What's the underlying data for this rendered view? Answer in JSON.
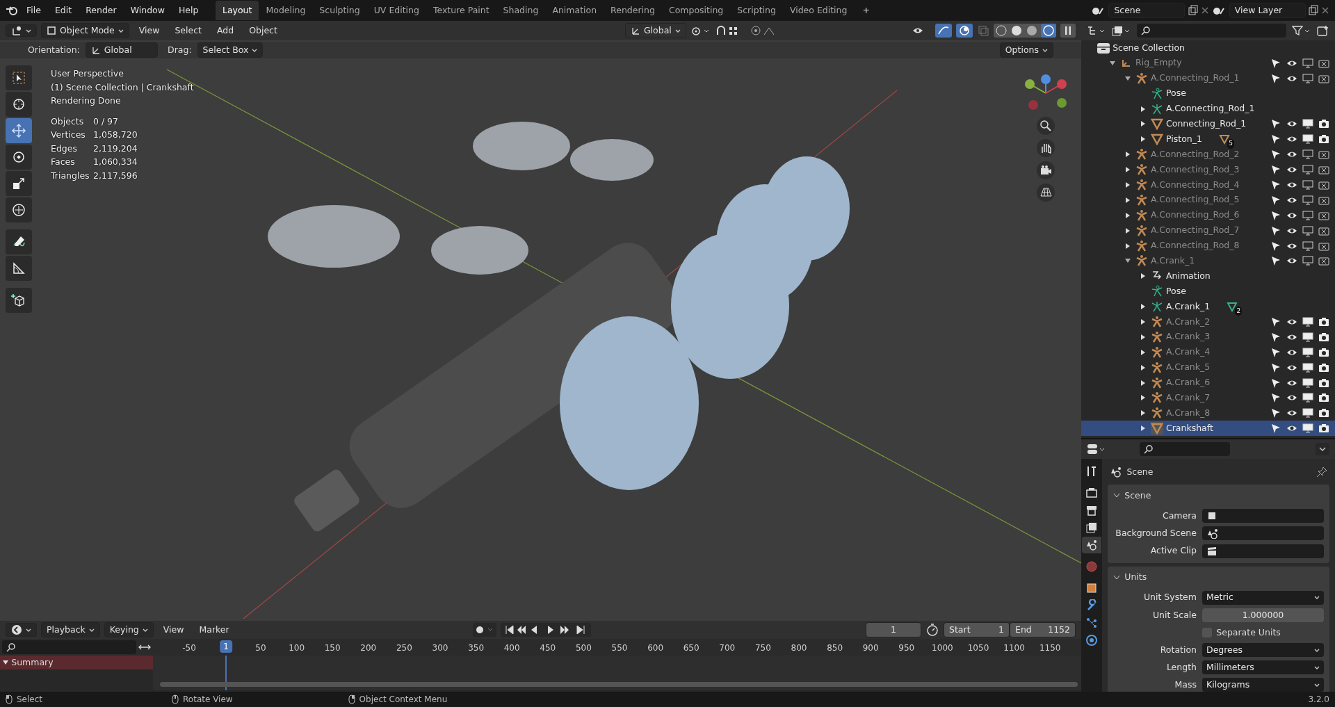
{
  "menu": [
    "File",
    "Edit",
    "Render",
    "Window",
    "Help"
  ],
  "workspaces": [
    {
      "label": "Layout",
      "selected": true
    },
    {
      "label": "Modeling",
      "selected": false
    },
    {
      "label": "Sculpting",
      "selected": false
    },
    {
      "label": "UV Editing",
      "selected": false
    },
    {
      "label": "Texture Paint",
      "selected": false
    },
    {
      "label": "Shading",
      "selected": false
    },
    {
      "label": "Animation",
      "selected": false
    },
    {
      "label": "Rendering",
      "selected": false
    },
    {
      "label": "Compositing",
      "selected": false
    },
    {
      "label": "Scripting",
      "selected": false
    },
    {
      "label": "Video Editing",
      "selected": false
    }
  ],
  "add_workspace": "+",
  "scene": "Scene",
  "view_layer": "View Layer",
  "viewport_header": {
    "mode": "Object Mode",
    "menus": [
      "View",
      "Select",
      "Add",
      "Object"
    ],
    "transform": "Global"
  },
  "tool_settings": {
    "orientation_label": "Orientation:",
    "orientation": "Global",
    "drag_label": "Drag:",
    "drag": "Select Box",
    "options": "Options"
  },
  "tools": [
    {
      "kind": "select",
      "selected": false
    },
    {
      "kind": "cursor",
      "selected": false
    },
    {
      "kind": "move",
      "selected": true
    },
    {
      "kind": "rotate",
      "selected": false
    },
    {
      "kind": "scale",
      "selected": false
    },
    {
      "kind": "transform",
      "selected": false
    },
    {
      "kind": "annotate",
      "selected": false
    },
    {
      "kind": "measure",
      "selected": false
    },
    {
      "kind": "add_cube",
      "selected": false
    }
  ],
  "overlay": {
    "lines": [
      "User Perspective",
      "(1) Scene Collection | Crankshaft",
      "Rendering Done"
    ],
    "stats": [
      {
        "label": "Objects",
        "value": "0 / 97"
      },
      {
        "label": "Vertices",
        "value": "1,058,720"
      },
      {
        "label": "Edges",
        "value": "2,119,204"
      },
      {
        "label": "Faces",
        "value": "1,060,334"
      },
      {
        "label": "Triangles",
        "value": "2,117,596"
      }
    ]
  },
  "outliner": {
    "root": "Scene Collection",
    "items": [
      {
        "name": "Rig_Empty",
        "kind": "empty",
        "disabled": true,
        "expanded": true,
        "selected": false,
        "renderable": false,
        "children": [
          {
            "name": "A.Connecting_Rod_1",
            "kind": "armature",
            "disabled": true,
            "expanded": true,
            "selected": false,
            "renderable": false,
            "children": [
              {
                "name": "Pose",
                "kind": "pose",
                "disabled": false,
                "selected": false
              },
              {
                "name": "A.Connecting_Rod_1",
                "kind": "armature_data",
                "disabled": false,
                "expanded": false,
                "selected": false
              },
              {
                "name": "Connecting_Rod_1",
                "kind": "mesh",
                "disabled": false,
                "expanded": false,
                "selected": false,
                "renderable": true
              },
              {
                "name": "Piston_1",
                "kind": "mesh",
                "disabled": false,
                "expanded": false,
                "selected": false,
                "renderable": true,
                "badge": "5"
              }
            ]
          },
          {
            "name": "A.Connecting_Rod_2",
            "kind": "armature",
            "disabled": true,
            "expanded": false,
            "selected": false,
            "renderable": false
          },
          {
            "name": "A.Connecting_Rod_3",
            "kind": "armature",
            "disabled": true,
            "expanded": false,
            "selected": false,
            "renderable": false
          },
          {
            "name": "A.Connecting_Rod_4",
            "kind": "armature",
            "disabled": true,
            "expanded": false,
            "selected": false,
            "renderable": false
          },
          {
            "name": "A.Connecting_Rod_5",
            "kind": "armature",
            "disabled": true,
            "expanded": false,
            "selected": false,
            "renderable": false
          },
          {
            "name": "A.Connecting_Rod_6",
            "kind": "armature",
            "disabled": true,
            "expanded": false,
            "selected": false,
            "renderable": false
          },
          {
            "name": "A.Connecting_Rod_7",
            "kind": "armature",
            "disabled": true,
            "expanded": false,
            "selected": false,
            "renderable": false
          },
          {
            "name": "A.Connecting_Rod_8",
            "kind": "armature",
            "disabled": true,
            "expanded": false,
            "selected": false,
            "renderable": false
          },
          {
            "name": "A.Crank_1",
            "kind": "armature",
            "disabled": true,
            "expanded": true,
            "selected": false,
            "renderable": false,
            "children": [
              {
                "name": "Animation",
                "kind": "animation",
                "disabled": false,
                "expanded": false,
                "selected": false
              },
              {
                "name": "Pose",
                "kind": "pose",
                "disabled": false,
                "selected": false
              },
              {
                "name": "A.Crank_1",
                "kind": "armature_data",
                "disabled": false,
                "expanded": false,
                "selected": false,
                "badge": "2"
              },
              {
                "name": "A.Crank_2",
                "kind": "armature",
                "disabled": true,
                "expanded": false,
                "selected": false,
                "renderable": true
              },
              {
                "name": "A.Crank_3",
                "kind": "armature",
                "disabled": true,
                "expanded": false,
                "selected": false,
                "renderable": true
              },
              {
                "name": "A.Crank_4",
                "kind": "armature",
                "disabled": true,
                "expanded": false,
                "selected": false,
                "renderable": true
              },
              {
                "name": "A.Crank_5",
                "kind": "armature",
                "disabled": true,
                "expanded": false,
                "selected": false,
                "renderable": true
              },
              {
                "name": "A.Crank_6",
                "kind": "armature",
                "disabled": true,
                "expanded": false,
                "selected": false,
                "renderable": true
              },
              {
                "name": "A.Crank_7",
                "kind": "armature",
                "disabled": true,
                "expanded": false,
                "selected": false,
                "renderable": true
              },
              {
                "name": "A.Crank_8",
                "kind": "armature",
                "disabled": true,
                "expanded": false,
                "selected": false,
                "renderable": true
              },
              {
                "name": "Crankshaft",
                "kind": "mesh",
                "disabled": false,
                "expanded": false,
                "selected": true,
                "renderable": true
              }
            ]
          }
        ]
      }
    ]
  },
  "properties": {
    "tabs": [
      {
        "kind": "tool",
        "selected": false
      },
      {
        "kind": "render",
        "selected": false
      },
      {
        "kind": "output",
        "selected": false
      },
      {
        "kind": "view_layer",
        "selected": false
      },
      {
        "kind": "scene",
        "selected": true
      },
      {
        "kind": "world",
        "selected": false
      },
      {
        "kind": "object",
        "selected": false
      },
      {
        "kind": "modifier",
        "selected": false
      },
      {
        "kind": "particles",
        "selected": false
      },
      {
        "kind": "physics",
        "selected": false
      }
    ],
    "context": "Scene",
    "panels": [
      {
        "title": "Scene",
        "expanded": true,
        "rows": [
          {
            "kind": "object_field",
            "label": "Camera"
          },
          {
            "kind": "object_field",
            "label": "Background Scene"
          },
          {
            "kind": "object_field",
            "label": "Active Clip"
          }
        ]
      },
      {
        "title": "Units",
        "expanded": true,
        "rows": [
          {
            "kind": "dropdown",
            "label": "Unit System",
            "value": "Metric"
          },
          {
            "kind": "number",
            "label": "Unit Scale",
            "value": "1.000000"
          },
          {
            "kind": "checkbox",
            "label": "Separate Units",
            "checked": false
          },
          {
            "kind": "dropdown",
            "label": "Rotation",
            "value": "Degrees"
          },
          {
            "kind": "dropdown",
            "label": "Length",
            "value": "Millimeters"
          },
          {
            "kind": "dropdown",
            "label": "Mass",
            "value": "Kilograms"
          }
        ]
      }
    ]
  },
  "timeline": {
    "menus": [
      "Playback",
      "Keying",
      "View",
      "Marker"
    ],
    "current_frame": "1",
    "start_label": "Start",
    "start": "1",
    "end_label": "End",
    "end": "1152",
    "ticks": [
      {
        "label": "-50",
        "selected": false
      },
      {
        "label": "1",
        "selected": true
      },
      {
        "label": "50",
        "selected": false
      },
      {
        "label": "100",
        "selected": false
      },
      {
        "label": "150",
        "selected": false
      },
      {
        "label": "200",
        "selected": false
      },
      {
        "label": "250",
        "selected": false
      },
      {
        "label": "300",
        "selected": false
      },
      {
        "label": "350",
        "selected": false
      },
      {
        "label": "400",
        "selected": false
      },
      {
        "label": "450",
        "selected": false
      },
      {
        "label": "500",
        "selected": false
      },
      {
        "label": "550",
        "selected": false
      },
      {
        "label": "600",
        "selected": false
      },
      {
        "label": "650",
        "selected": false
      },
      {
        "label": "700",
        "selected": false
      },
      {
        "label": "750",
        "selected": false
      },
      {
        "label": "800",
        "selected": false
      },
      {
        "label": "850",
        "selected": false
      },
      {
        "label": "900",
        "selected": false
      },
      {
        "label": "950",
        "selected": false
      },
      {
        "label": "1000",
        "selected": false
      },
      {
        "label": "1050",
        "selected": false
      },
      {
        "label": "1100",
        "selected": false
      },
      {
        "label": "1150",
        "selected": false
      }
    ],
    "channels": [
      "Summary"
    ]
  },
  "status_bar": {
    "hints": [
      "Select",
      "Rotate View",
      "Object Context Menu"
    ],
    "version": "3.2.0"
  }
}
